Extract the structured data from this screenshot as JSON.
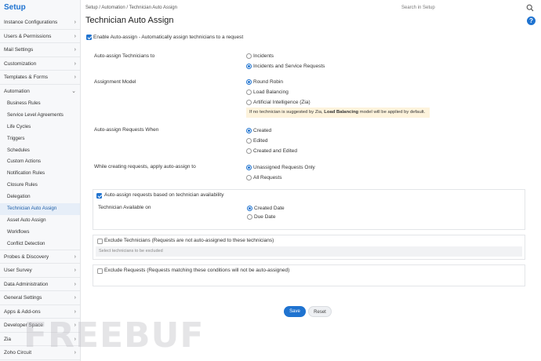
{
  "sidebar": {
    "title": "Setup",
    "top_items": [
      {
        "label": "Instance Configurations"
      },
      {
        "label": "Users & Permissions"
      },
      {
        "label": "Mail Settings"
      },
      {
        "label": "Customization"
      },
      {
        "label": "Templates & Forms"
      },
      {
        "label": "Automation"
      }
    ],
    "sub_items": [
      {
        "label": "Business Rules"
      },
      {
        "label": "Service Level Agreements"
      },
      {
        "label": "Life Cycles"
      },
      {
        "label": "Triggers"
      },
      {
        "label": "Schedules"
      },
      {
        "label": "Custom Actions"
      },
      {
        "label": "Notification Rules"
      },
      {
        "label": "Closure Rules"
      },
      {
        "label": "Delegation"
      },
      {
        "label": "Technician Auto Assign"
      },
      {
        "label": "Asset Auto Assign"
      },
      {
        "label": "Workflows"
      },
      {
        "label": "Conflict Detection"
      }
    ],
    "bottom_items": [
      {
        "label": "Probes & Discovery"
      },
      {
        "label": "User Survey"
      },
      {
        "label": "Data Administration"
      },
      {
        "label": "General Settings"
      },
      {
        "label": "Apps & Add-ons"
      },
      {
        "label": "Developer Space"
      },
      {
        "label": "Zia"
      },
      {
        "label": "Zoho Circuit"
      }
    ]
  },
  "header": {
    "breadcrumb": "Setup / Automation / Technician Auto Assign",
    "search_placeholder": "Search in Setup",
    "help": "?"
  },
  "page": {
    "title": "Technician Auto Assign",
    "enable_label": "Enable Auto-assign - Automatically assign technicians to a request",
    "auto_assign_to": {
      "label": "Auto-assign Technicians to",
      "options": [
        "Incidents",
        "Incidents and Service Requests"
      ]
    },
    "assignment_model": {
      "label": "Assignment Model",
      "options": [
        "Round Robin",
        "Load Balancing",
        "Artificial Intelligence (Zia)"
      ],
      "note_pre": "If no technician is suggested by Zia,",
      "note_bold": "Load Balancing",
      "note_post": "model will be applied by default."
    },
    "requests_when": {
      "label": "Auto-assign Requests When",
      "options": [
        "Created",
        "Edited",
        "Created and Edited"
      ]
    },
    "creating_requests": {
      "label": "While creating requests, apply auto-assign to",
      "options": [
        "Unassigned Requests Only",
        "All Requests"
      ]
    },
    "availability": {
      "checkbox_label": "Auto-assign requests based on technician availability",
      "field_label": "Technician Available on",
      "options": [
        "Created Date",
        "Due Date"
      ]
    },
    "exclude_technicians": {
      "label": "Exclude Technicians (Requests are not auto-assigned to these technicians)",
      "placeholder": "Select technicians to be excluded"
    },
    "exclude_requests": {
      "label": "Exclude Requests (Requests matching these conditions will not be auto-assigned)"
    },
    "save_label": "Save",
    "reset_label": "Reset"
  },
  "watermark": "FREEBUF",
  "colors": {
    "accent": "#1f73d0",
    "note_bg": "#fdf3dc"
  }
}
